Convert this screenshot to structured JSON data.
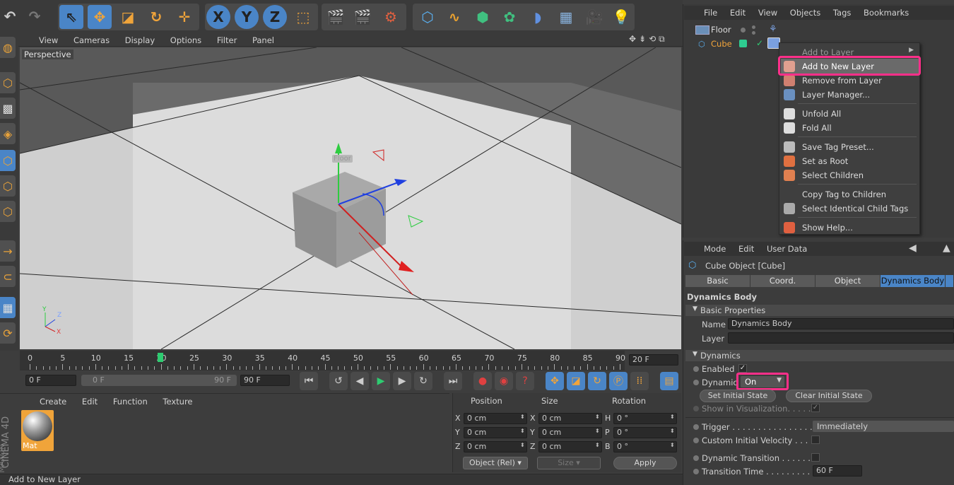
{
  "viewport": {
    "menu": [
      "View",
      "Cameras",
      "Display",
      "Options",
      "Filter",
      "Panel"
    ],
    "label": "Perspective",
    "object_tag": "Floor",
    "axis_y": "Y",
    "axis_z": "Z",
    "axis_x": "X"
  },
  "toolbar": {
    "x_label": "X",
    "y_label": "Y",
    "z_label": "Z"
  },
  "timeline": {
    "ticks": [
      "0",
      "5",
      "10",
      "15",
      "20",
      "25",
      "30",
      "35",
      "40",
      "45",
      "50",
      "55",
      "60",
      "65",
      "70",
      "75",
      "80",
      "85",
      "90"
    ],
    "current_frame": "20 F",
    "start_field": "0 F",
    "range_left": "0 F",
    "range_right": "90 F",
    "end_field": "90 F"
  },
  "material": {
    "menu": [
      "Create",
      "Edit",
      "Function",
      "Texture"
    ],
    "mat_name": "Mat",
    "brand1": "MAXON",
    "brand2": "CINEMA 4D"
  },
  "coords": {
    "headers": [
      "Position",
      "Size",
      "Rotation"
    ],
    "rows": [
      {
        "a": "X",
        "av": "0 cm",
        "b": "X",
        "bv": "0 cm",
        "c": "H",
        "cv": "0 °"
      },
      {
        "a": "Y",
        "av": "0 cm",
        "b": "Y",
        "bv": "0 cm",
        "c": "P",
        "cv": "0 °"
      },
      {
        "a": "Z",
        "av": "0 cm",
        "b": "Z",
        "bv": "0 cm",
        "c": "B",
        "cv": "0 °"
      }
    ],
    "mode": "Object (Rel)",
    "size_mode": "Size",
    "apply": "Apply"
  },
  "status": "Add to New Layer",
  "objects": {
    "menu": [
      "File",
      "Edit",
      "View",
      "Objects",
      "Tags",
      "Bookmarks"
    ],
    "items": [
      "Floor",
      "Cube"
    ]
  },
  "context_menu": {
    "items": [
      {
        "label": "Add to Layer"
      },
      {
        "label": "Add to New Layer"
      },
      {
        "label": "Remove from Layer"
      },
      {
        "label": "Layer Manager..."
      },
      {
        "label": "Unfold All"
      },
      {
        "label": "Fold All"
      },
      {
        "label": "Save Tag Preset..."
      },
      {
        "label": "Set as Root"
      },
      {
        "label": "Select Children"
      },
      {
        "label": "Copy Tag to Children"
      },
      {
        "label": "Select Identical Child Tags"
      },
      {
        "label": "Show Help..."
      }
    ]
  },
  "attributes": {
    "menu": [
      "Mode",
      "Edit",
      "User Data"
    ],
    "object_title": "Cube Object [Cube]",
    "tabs": [
      "Basic",
      "Coord.",
      "Object",
      "Dynamics Body"
    ],
    "section": "Dynamics Body",
    "basic_props": "Basic Properties",
    "name_label": "Name",
    "name_value": "Dynamics Body",
    "layer_label": "Layer",
    "dynamics_group": "Dynamics",
    "enabled_label": "Enabled",
    "dynamic_label": "Dynamic",
    "dynamic_value": "On",
    "set_initial": "Set Initial State",
    "clear_initial": "Clear Initial State",
    "show_in_vis": "Show in Visualization. . . . .",
    "trigger_label": "Trigger . . . . . . . . . . . . . . . .",
    "trigger_value": "Immediately",
    "custom_vel": "Custom Initial Velocity . . . .",
    "dyn_transition": "Dynamic Transition . . . . . . .",
    "transition_time": "Transition Time . . . . . . . . . .",
    "transition_value": "60 F"
  },
  "colors": {
    "highlight": "#ff2f8a",
    "accent_blue": "#4a85c7",
    "orange": "#f0a43a"
  }
}
